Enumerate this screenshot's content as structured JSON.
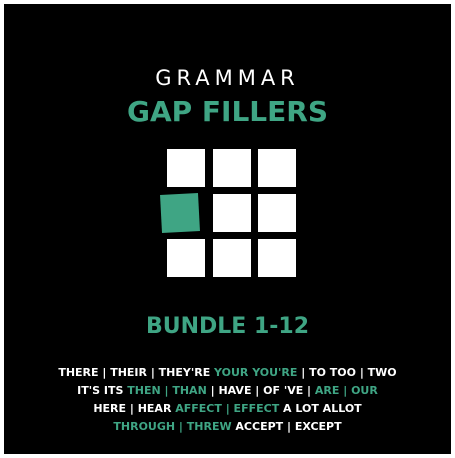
{
  "cover": {
    "title_top": "GRAMMAR",
    "title_main": "GAP FILLERS",
    "bundle": "BUNDLE 1-12",
    "colors": {
      "background": "#000000",
      "accent": "#3fa584",
      "text": "#ffffff"
    },
    "grid_icon": "nine-tile-grid-icon",
    "word_lines": [
      [
        {
          "text": "THERE | THEIR | THEY'RE ",
          "color": "white"
        },
        {
          "text": "YOUR  YOU'RE",
          "color": "green"
        },
        {
          "text": " | TO  TOO | TWO",
          "color": "white"
        }
      ],
      [
        {
          "text": "IT'S  ITS  ",
          "color": "white"
        },
        {
          "text": "THEN | THAN",
          "color": "green"
        },
        {
          "text": " | HAVE | OF  'VE | ",
          "color": "white"
        },
        {
          "text": "ARE | OUR",
          "color": "green"
        }
      ],
      [
        {
          "text": "HERE | HEAR  ",
          "color": "white"
        },
        {
          "text": "AFFECT | EFFECT",
          "color": "green"
        },
        {
          "text": "  A LOT  ALLOT",
          "color": "white"
        }
      ],
      [
        {
          "text": "THROUGH | THREW",
          "color": "green"
        },
        {
          "text": "  ACCEPT | EXCEPT",
          "color": "white"
        }
      ]
    ]
  }
}
